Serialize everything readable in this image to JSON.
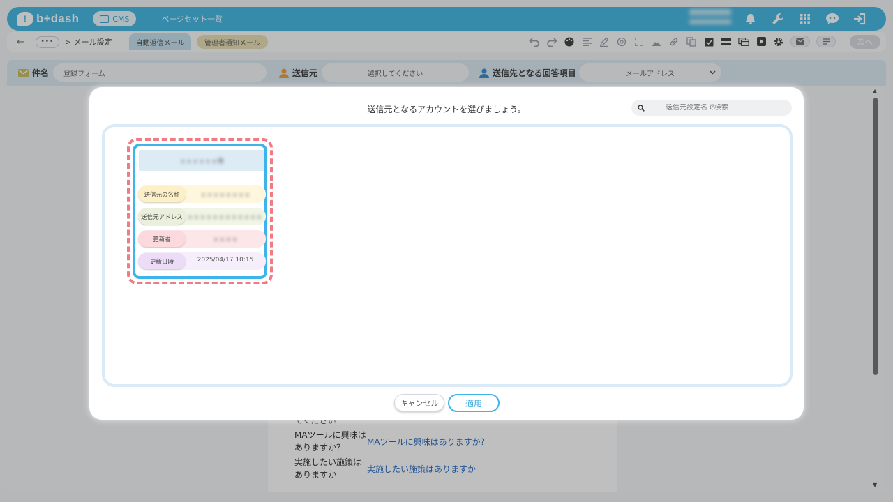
{
  "header": {
    "logo_text": "b+dash",
    "cms_label": "CMS",
    "page_title": "ページセット一覧"
  },
  "subbar": {
    "back_label": "←",
    "dots_label": "•••",
    "breadcrumb": "> メール設定",
    "tab_auto_reply": "自動返信メール",
    "tab_admin_notice": "管理者通知メール",
    "next_label": "次へ"
  },
  "form": {
    "subject_label": "件名",
    "subject_value": "登録フォーム",
    "sender_label": "送信元",
    "sender_placeholder": "選択してください",
    "recipient_label": "送信先となる回答項目",
    "recipient_value": "メールアドレス"
  },
  "preview": {
    "row0_text": "てください",
    "row1_label_line1": "MAツールに興味は",
    "row1_label_line2": "ありますか？",
    "row1_link": "MAツールに興味はありますか？",
    "row2_label_line1": "実施したい施策は",
    "row2_label_line2": "ありますか",
    "row2_link": "実施したい施策はありますか"
  },
  "modal": {
    "title": "送信元となるアカウントを選びましょう。",
    "search_placeholder": "送信元設定名で検索",
    "card": {
      "header": "ｘｘｘｘｘｘ用",
      "rows": [
        {
          "label": "送信元の名称",
          "value": "ｘｘｘｘｘｘｘｘ"
        },
        {
          "label": "送信元アドレス",
          "value": "ｘｘｘｘｘｘｘｘｘｘｘｘｘｘｘ..."
        },
        {
          "label": "更新者",
          "value": "ｘｘｘｘ"
        },
        {
          "label": "更新日時",
          "value": "2025/04/17 10:15"
        }
      ]
    },
    "cancel_label": "キャンセル",
    "apply_label": "適用"
  },
  "colors": {
    "brand": "#49b9e3",
    "card_border": "#3fb4ea",
    "highlight_dashed": "#f17b84"
  }
}
